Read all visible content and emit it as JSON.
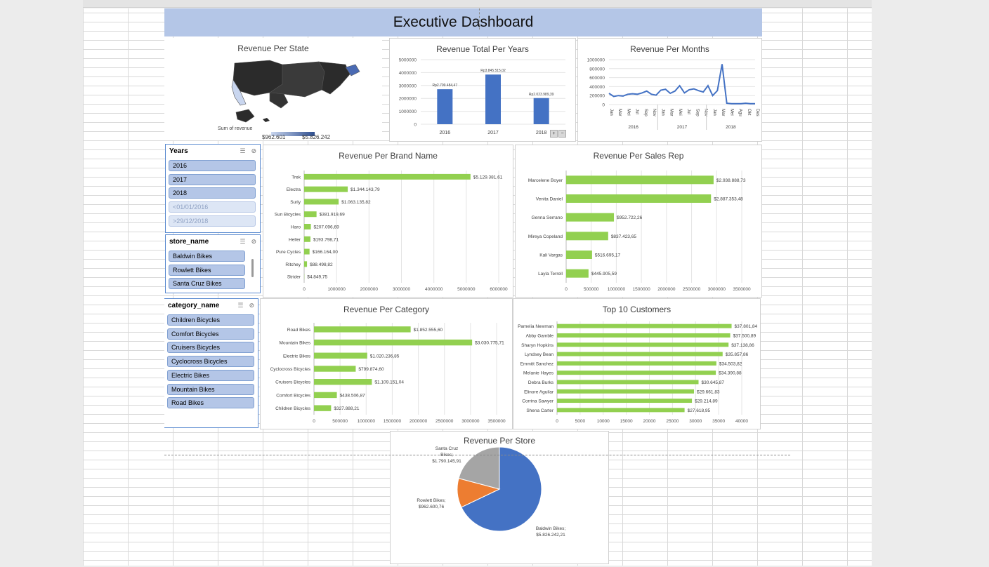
{
  "dashboard_title": "Executive Dashboard",
  "map": {
    "title": "Revenue Per State",
    "legend_label": "Sum of revenue",
    "legend_min": "$962.601",
    "legend_max": "$5.826.242",
    "colors": [
      "#c9d6ef",
      "#2e4e8f"
    ]
  },
  "slicers": {
    "years": {
      "title": "Years",
      "items": [
        {
          "label": "2016",
          "on": true
        },
        {
          "label": "2017",
          "on": true
        },
        {
          "label": "2018",
          "on": true
        },
        {
          "label": "<01/01/2016",
          "on": false
        },
        {
          "label": ">29/12/2018",
          "on": false
        }
      ]
    },
    "store": {
      "title": "store_name",
      "items": [
        {
          "label": "Baldwin Bikes",
          "on": true
        },
        {
          "label": "Rowlett Bikes",
          "on": true
        },
        {
          "label": "Santa Cruz Bikes",
          "on": true
        }
      ]
    },
    "category": {
      "title": "category_name",
      "items": [
        {
          "label": "Children Bicycles",
          "on": true
        },
        {
          "label": "Comfort Bicycles",
          "on": true
        },
        {
          "label": "Cruisers Bicycles",
          "on": true
        },
        {
          "label": "Cyclocross Bicycles",
          "on": true
        },
        {
          "label": "Electric Bikes",
          "on": true
        },
        {
          "label": "Mountain Bikes",
          "on": true
        },
        {
          "label": "Road Bikes",
          "on": true
        }
      ]
    }
  },
  "chart_data": [
    {
      "id": "years",
      "type": "bar",
      "title": "Revenue Total Per Years",
      "categories": [
        "2016",
        "2017",
        "2018"
      ],
      "values": [
        2709484.47,
        3845515.02,
        2023989.39
      ],
      "labels": [
        "Rp2.709.484,47",
        "Rp3.845.515,02",
        "Rp2.023.989,39"
      ],
      "ylim": [
        0,
        5000000
      ],
      "yticks": [
        "0",
        "1000000",
        "2000000",
        "3000000",
        "4000000",
        "5000000"
      ],
      "color": "#4472c4"
    },
    {
      "id": "months",
      "type": "line",
      "title": "Revenue Per Months",
      "months": [
        "Jan",
        "Mar",
        "Mei",
        "Jul",
        "Sep",
        "Nov",
        "Jan",
        "Mar",
        "Mei",
        "Jul",
        "Sep",
        "Nov",
        "Jan",
        "Mar",
        "Mei",
        "Agu",
        "Okt",
        "Des"
      ],
      "years": [
        "2016",
        "2017",
        "2018"
      ],
      "values": [
        250000,
        180000,
        200000,
        190000,
        230000,
        240000,
        230000,
        260000,
        300000,
        230000,
        210000,
        320000,
        340000,
        250000,
        300000,
        420000,
        260000,
        330000,
        350000,
        310000,
        280000,
        420000,
        200000,
        310000,
        900000,
        30000,
        20000,
        20000,
        20000,
        30000,
        20000,
        20000
      ],
      "ylim": [
        0,
        1000000
      ],
      "yticks": [
        "0",
        "200000",
        "400000",
        "600000",
        "800000",
        "1000000"
      ],
      "color": "#4472c4"
    },
    {
      "id": "brand",
      "type": "bar",
      "title": "Revenue Per Brand Name",
      "categories": [
        "Trek",
        "Electra",
        "Surly",
        "Sun Bicycles",
        "Haro",
        "Heller",
        "Pure Cycles",
        "Ritchey",
        "Strider"
      ],
      "values": [
        5129381.61,
        1344143.79,
        1063135.82,
        381919.69,
        207096.69,
        193798.71,
        166164.0,
        88498.82,
        4849.75
      ],
      "labels": [
        "$5.129.381,61",
        "$1.344.143,79",
        "$1.063.135,82",
        "$381.919,69",
        "$207.096,69",
        "$193.798,71",
        "$166.164,00",
        "$88.498,82",
        "$4.849,75"
      ],
      "xlim": [
        0,
        6000000
      ],
      "xticks": [
        "0",
        "1000000",
        "2000000",
        "3000000",
        "4000000",
        "5000000",
        "6000000"
      ],
      "color": "#92d050"
    },
    {
      "id": "rep",
      "type": "bar",
      "title": "Revenue Per Sales Rep",
      "categories": [
        "Marcelene Boyer",
        "Venita Daniel",
        "Genna Serrano",
        "Mireya Copeland",
        "Kali Vargas",
        "Layla Terrell"
      ],
      "values": [
        2938888.73,
        2887353.48,
        952722.26,
        837423.65,
        516695.17,
        445905.59
      ],
      "labels": [
        "$2.938.888,73",
        "$2.887.353,48",
        "$952.722,26",
        "$837.423,65",
        "$516.695,17",
        "$445.905,59"
      ],
      "xlim": [
        0,
        3500000
      ],
      "xticks": [
        "0",
        "500000",
        "1000000",
        "1500000",
        "2000000",
        "2500000",
        "3000000",
        "3500000"
      ],
      "color": "#92d050"
    },
    {
      "id": "category",
      "type": "bar",
      "title": "Revenue Per Category",
      "categories": [
        "Road Bikes",
        "Mountain Bikes",
        "Electric Bikes",
        "Cyclocross Bicycles",
        "Cruisers Bicycles",
        "Comfort Bicycles",
        "Children Bicycles"
      ],
      "values": [
        1852555.6,
        3030775.71,
        1020236.85,
        799874.6,
        1109151.04,
        438506.87,
        327888.21
      ],
      "labels": [
        "$1.852.555,60",
        "$3.030.775,71",
        "$1.020.236,85",
        "$799.874,60",
        "$1.109.151,04",
        "$438.506,87",
        "$327.888,21"
      ],
      "xlim": [
        0,
        3500000
      ],
      "xticks": [
        "0",
        "500000",
        "1000000",
        "1500000",
        "2000000",
        "2500000",
        "3000000",
        "3500000"
      ],
      "color": "#92d050"
    },
    {
      "id": "customers",
      "type": "bar",
      "title": "Top 10 Customers",
      "categories": [
        "Pamelia Newman",
        "Abby Gamble",
        "Sharyn Hopkins",
        "Lyndsey Bean",
        "Emmitt Sanchez",
        "Melanie Hayes",
        "Debra Burks",
        "Elinore Aguilar",
        "Corrina Sawyer",
        "Shena Carter"
      ],
      "values": [
        37801.84,
        37500.89,
        37138.86,
        35857.86,
        34503.82,
        34390.88,
        30645.87,
        29661.83,
        29214.89,
        27618.95
      ],
      "labels": [
        "$37.801,84",
        "$37.500,89",
        "$37.138,86",
        "$35.857,86",
        "$34.503,82",
        "$34.390,88",
        "$30.645,87",
        "$29.661,83",
        "$29.214,89",
        "$27.618,95"
      ],
      "xlim": [
        0,
        40000
      ],
      "xticks": [
        "0",
        "5000",
        "10000",
        "15000",
        "20000",
        "25000",
        "30000",
        "35000",
        "40000"
      ],
      "color": "#92d050"
    },
    {
      "id": "store",
      "type": "pie",
      "title": "Revenue Per Store",
      "categories": [
        "Baldwin Bikes",
        "Rowlett Bikes",
        "Santa Cruz Bikes"
      ],
      "values": [
        5826242.21,
        962600.76,
        1790145.91
      ],
      "labels": [
        "Baldwin Bikes; $5.826.242,21",
        "Rowlett Bikes; $962.600,76",
        "Santa Cruz Bikes; $1.790.145,91"
      ],
      "colors": [
        "#4472c4",
        "#ed7d31",
        "#a5a5a5"
      ]
    }
  ]
}
